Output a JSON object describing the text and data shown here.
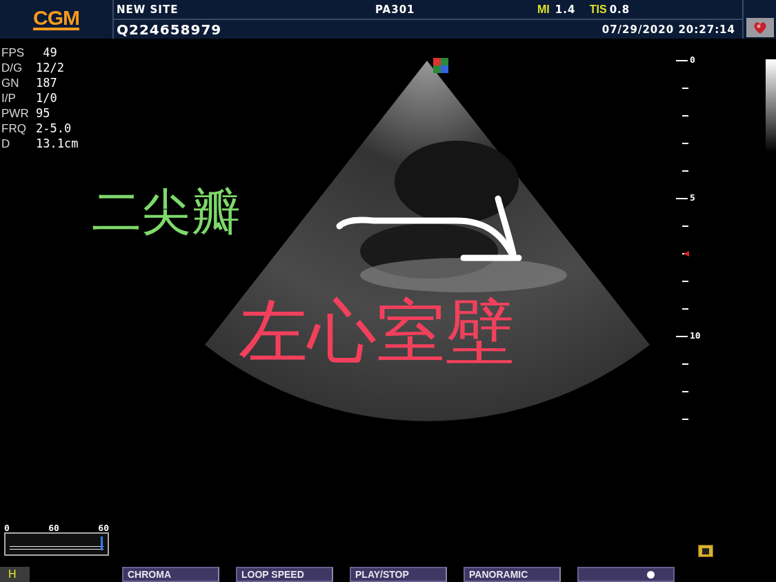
{
  "header": {
    "logo": "CGM",
    "site": "NEW SITE",
    "probe": "PA301",
    "mi": {
      "label": "MI",
      "value": "1.4"
    },
    "tis": {
      "label": "TIS",
      "value": "0.8"
    },
    "patient_id": "Q224658979",
    "datetime": "07/29/2020 20:27:14"
  },
  "parameters": [
    {
      "label": "FPS",
      "value": " 49"
    },
    {
      "label": "D/G",
      "value": "12/2"
    },
    {
      "label": "GN",
      "value": "187"
    },
    {
      "label": "I/P",
      "value": "1/0"
    },
    {
      "label": "PWR",
      "value": "95"
    },
    {
      "label": "FRQ",
      "value": "2-5.0"
    },
    {
      "label": "D",
      "value": "13.1cm"
    }
  ],
  "annotations": [
    {
      "text": "二尖瓣",
      "color": "#7ed96b"
    },
    {
      "text": "左心室壁",
      "color": "#f2405c"
    }
  ],
  "depth_labels": [
    "0",
    "5",
    "10"
  ],
  "cine": {
    "labels": [
      "0",
      "60",
      "60"
    ],
    "level": 1
  },
  "mode": "H",
  "buttons": [
    {
      "kind": "button",
      "label": "CHROMA"
    },
    {
      "kind": "button",
      "label": "LOOP SPEED"
    },
    {
      "kind": "button",
      "label": "PLAY/STOP"
    },
    {
      "kind": "button",
      "label": "PANORAMIC"
    },
    {
      "kind": "slider",
      "level": 0.77
    }
  ]
}
